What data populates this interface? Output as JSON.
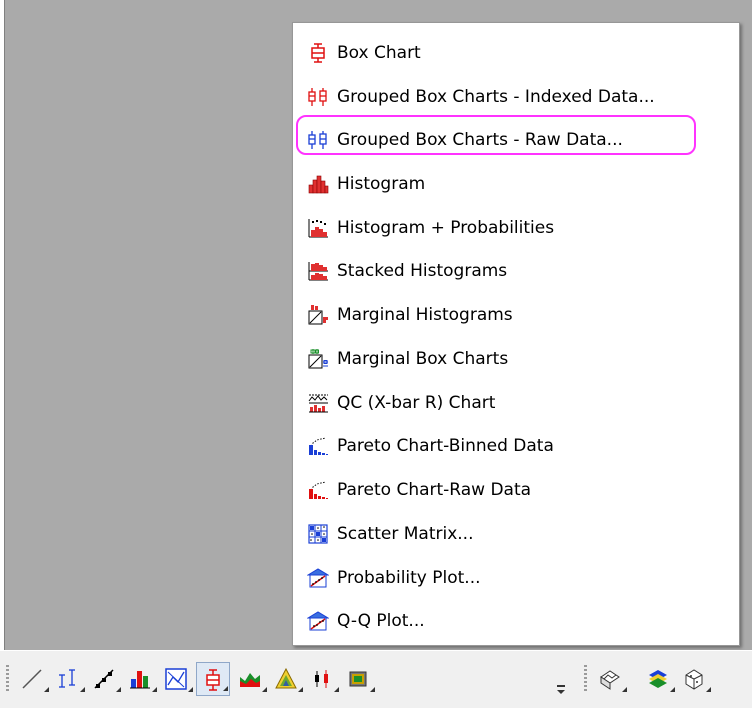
{
  "menu": {
    "items": [
      {
        "label": "Box Chart",
        "icon": "box-chart-icon"
      },
      {
        "label": "Grouped Box Charts - Indexed Data...",
        "icon": "grouped-box-indexed-icon"
      },
      {
        "label": "Grouped Box Charts - Raw Data...",
        "icon": "grouped-box-raw-icon"
      },
      {
        "label": "Histogram",
        "icon": "histogram-icon"
      },
      {
        "label": "Histogram + Probabilities",
        "icon": "histogram-probabilities-icon"
      },
      {
        "label": "Stacked Histograms",
        "icon": "stacked-histograms-icon"
      },
      {
        "label": "Marginal Histograms",
        "icon": "marginal-histograms-icon"
      },
      {
        "label": "Marginal Box Charts",
        "icon": "marginal-box-charts-icon"
      },
      {
        "label": "QC (X-bar R) Chart",
        "icon": "qc-chart-icon"
      },
      {
        "label": "Pareto Chart-Binned Data",
        "icon": "pareto-binned-icon"
      },
      {
        "label": "Pareto Chart-Raw Data",
        "icon": "pareto-raw-icon"
      },
      {
        "label": "Scatter Matrix...",
        "icon": "scatter-matrix-icon"
      },
      {
        "label": "Probability Plot...",
        "icon": "probability-plot-icon"
      },
      {
        "label": "Q-Q Plot...",
        "icon": "qq-plot-icon"
      }
    ],
    "highlighted_item": "Grouped Box Charts - Raw Data...",
    "highlight_color": "#ff33ff"
  },
  "toolbar": {
    "buttons": [
      {
        "icon": "line-plot-icon"
      },
      {
        "icon": "error-bar-icon"
      },
      {
        "icon": "line-symbol-icon"
      },
      {
        "icon": "column-plot-icon"
      },
      {
        "icon": "scatter-frame-icon"
      },
      {
        "icon": "box-chart-icon",
        "pressed": true
      },
      {
        "icon": "area-plot-icon"
      },
      {
        "icon": "ternary-plot-icon"
      },
      {
        "icon": "high-low-close-icon"
      },
      {
        "icon": "image-plot-icon"
      },
      {
        "icon": "3d-wire-icon"
      },
      {
        "icon": "3d-surface-icon"
      },
      {
        "icon": "3d-box-icon"
      }
    ]
  },
  "colors": {
    "workspace": "#aaaaaa",
    "menu_bg": "#ffffff",
    "toolbar_bg": "#f0f0f0"
  }
}
